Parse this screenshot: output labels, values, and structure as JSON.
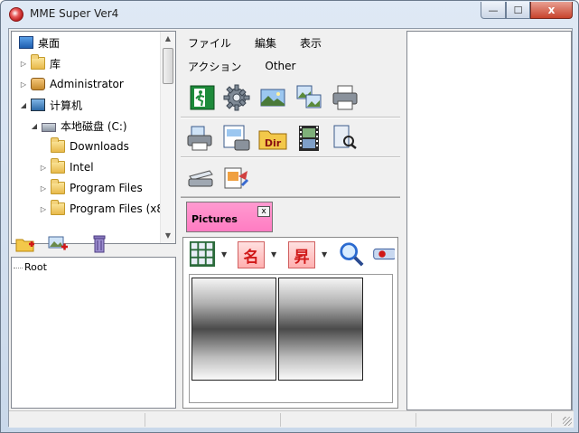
{
  "window": {
    "title": "MME Super Ver4",
    "min_label": "—",
    "max_label": "☐",
    "close_label": "x"
  },
  "tree": {
    "items": [
      {
        "label": "桌面",
        "icon": "desktop-icon",
        "expander": "",
        "indent": 0
      },
      {
        "label": "库",
        "icon": "library-folder-icon",
        "expander": "▷",
        "indent": 1
      },
      {
        "label": "Administrator",
        "icon": "user-folder-icon",
        "expander": "▷",
        "indent": 1
      },
      {
        "label": "计算机",
        "icon": "computer-icon",
        "expander": "◢",
        "indent": 1
      },
      {
        "label": "本地磁盘 (C:)",
        "icon": "drive-icon",
        "expander": "◢",
        "indent": 2
      },
      {
        "label": "Downloads",
        "icon": "folder-icon",
        "expander": "",
        "indent": 3
      },
      {
        "label": "Intel",
        "icon": "folder-icon",
        "expander": "▷",
        "indent": 3
      },
      {
        "label": "Program Files",
        "icon": "folder-icon",
        "expander": "▷",
        "indent": 3
      },
      {
        "label": "Program Files (x86",
        "icon": "folder-icon",
        "expander": "▷",
        "indent": 3
      }
    ]
  },
  "left_toolbar": [
    "new-folder-icon",
    "add-image-icon",
    "trash-icon"
  ],
  "root_tree": {
    "label": "Root"
  },
  "menu": {
    "row1": [
      "ファイル",
      "編集",
      "表示"
    ],
    "row2": [
      "アクション",
      "Other"
    ]
  },
  "toolbar": {
    "row1": [
      "exit-icon",
      "settings-gear-icon",
      "landscape-image-icon",
      "image-gallery-icon",
      "printer-icon"
    ],
    "row2": [
      "print-preview-icon",
      "print-layout-icon",
      "directory-icon",
      "film-strip-icon",
      "search-document-icon"
    ],
    "row3": [
      "scanner-icon",
      "export-image-icon"
    ],
    "dir_label": "Dir"
  },
  "tab": {
    "label": "Pictures",
    "close_label": "x"
  },
  "content_toolbar": {
    "sort_name_label": "名",
    "sort_asc_label": "昇"
  },
  "colors": {
    "tab_bg": "#ff8cc8",
    "close_red": "#c8432c",
    "kanji_red": "#d01818"
  }
}
